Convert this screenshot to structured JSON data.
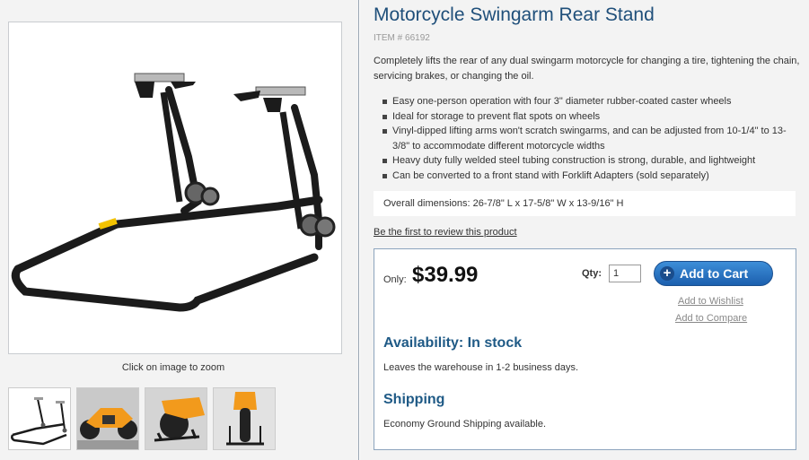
{
  "product": {
    "title": "Motorcycle Swingarm Rear Stand",
    "item_number": "ITEM # 66192",
    "description": "Completely lifts the rear of any dual swingarm motorcycle for changing a tire, tightening the chain, servicing brakes, or changing the oil.",
    "features": [
      "Easy one-person operation with four 3\" diameter rubber-coated caster wheels",
      "Ideal for storage to prevent flat spots on wheels",
      "Vinyl-dipped lifting arms won't scratch swingarms, and can be adjusted from 10-1/4\" to 13-3/8\" to accommodate different motorcycle widths",
      "Heavy duty fully welded steel tubing construction is strong, durable, and lightweight",
      "Can be converted to a front stand with Forklift Adapters (sold separately)"
    ],
    "dimensions": "Overall dimensions: 26-7/8\" L x 17-5/8\" W x 13-9/16\" H",
    "review_link": "Be the first to review this product"
  },
  "gallery": {
    "zoom_hint": "Click on image to zoom",
    "thumbnails": [
      "stand-only",
      "orange-motorcycle-side",
      "orange-motorcycle-rear-quarter",
      "orange-motorcycle-rear"
    ]
  },
  "buybox": {
    "only_label": "Only:",
    "price": "$39.99",
    "qty_label": "Qty:",
    "qty_value": "1",
    "add_to_cart": "Add to Cart",
    "add_to_wishlist": "Add to Wishlist",
    "add_to_compare": "Add to Compare",
    "availability": "Availability: In stock",
    "availability_note": "Leaves the warehouse in 1-2 business days.",
    "shipping_heading": "Shipping",
    "shipping_note": "Economy Ground Shipping available."
  },
  "colors": {
    "title": "#1f4f7a",
    "accent_button": "#2a77c7",
    "heading_blue": "#1f5a86",
    "motorcycle_orange": "#f29a1c"
  }
}
